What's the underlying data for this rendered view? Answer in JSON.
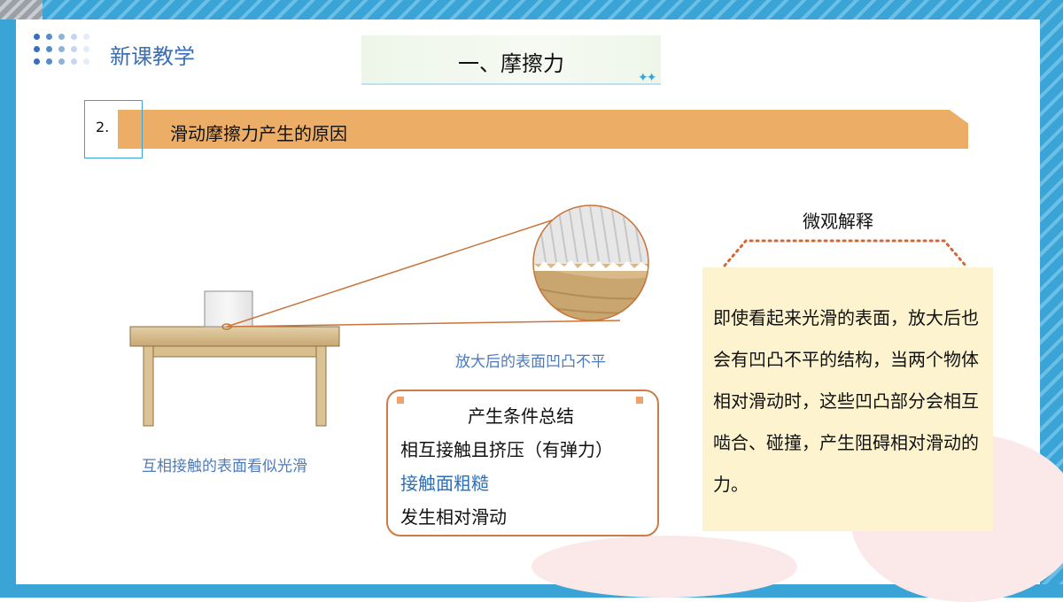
{
  "header": {
    "brand": "新课教学",
    "title": "一、摩擦力",
    "title_decoration": "✦✦"
  },
  "section": {
    "number": "2.",
    "title": "滑动摩擦力产生的原因"
  },
  "figure": {
    "caption_left": "互相接触的表面看似光滑",
    "caption_zoom": "放大后的表面凹凸不平"
  },
  "conditions": {
    "title": "产生条件总结",
    "items": [
      "相互接触且挤压（有弹力）",
      "接触面粗糙",
      "发生相对滑动"
    ]
  },
  "micro": {
    "title": "微观解释",
    "text": "即使看起来光滑的表面，放大后也会有凹凸不平的结构，当两个物体相对滑动时，这些凹凸部分会相互啮合、碰撞，产生阻碍相对滑动的力。"
  },
  "colors": {
    "frame": "#3aa4d6",
    "section_bar": "#ecae67",
    "highlight_text": "#2a6fb8",
    "box_border": "#d07a45",
    "note_bg": "#fdf3cf"
  }
}
